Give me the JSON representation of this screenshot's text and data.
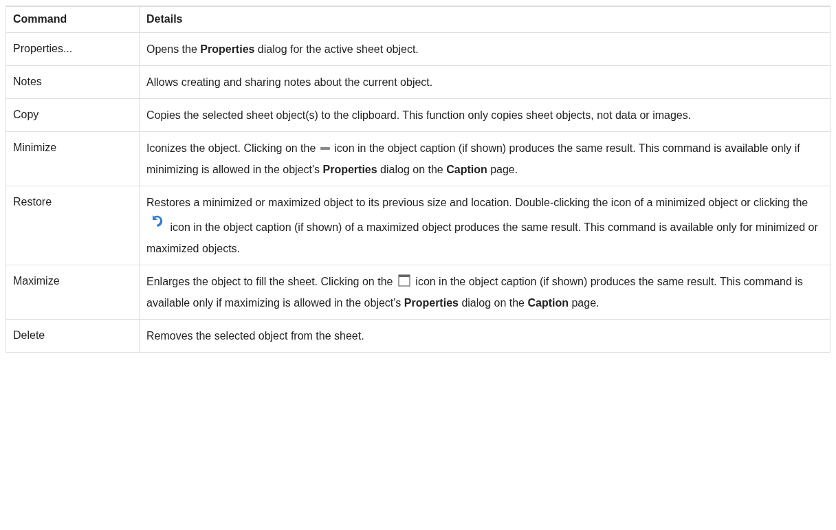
{
  "table": {
    "columns": [
      "Command",
      "Details"
    ],
    "rows": [
      {
        "command": "Properties...",
        "details": [
          {
            "kind": "text",
            "text": "Opens the **Properties** dialog for the active sheet object."
          }
        ]
      },
      {
        "command": "Notes",
        "details": [
          {
            "kind": "text",
            "text": "Allows creating and sharing notes about the current object."
          }
        ]
      },
      {
        "command": "Copy",
        "details": [
          {
            "kind": "text",
            "text": "Copies the selected sheet object(s) to the clipboard. This function only copies sheet objects, not data or images."
          }
        ]
      },
      {
        "command": "Minimize",
        "details": [
          {
            "kind": "text",
            "text": "Iconizes the object. Clicking on the "
          },
          {
            "kind": "dash"
          },
          {
            "kind": "text",
            "text": " icon in the object caption (if shown) produces the same result. This command is available only if minimizing is allowed in the object's **Properties** dialog on the **Caption** page."
          }
        ]
      },
      {
        "command": "Restore",
        "details": [
          {
            "kind": "text",
            "text": "Restores a minimized or maximized object to its previous size and location. Double-clicking the icon of a minimized object or clicking the "
          },
          {
            "kind": "undo"
          },
          {
            "kind": "text",
            "text": " icon in the object caption (if shown) of a maximized object produces the same result. This command is available only for minimized or maximized objects."
          }
        ]
      },
      {
        "command": "Maximize",
        "details": [
          {
            "kind": "text",
            "text": "Enlarges the object to fill the sheet. Clicking on the "
          },
          {
            "kind": "window"
          },
          {
            "kind": "text",
            "text": " icon in the object caption (if shown) produces the same result. This command is available only if maximizing is allowed in the object's **Properties** dialog on the **Caption** page."
          }
        ]
      },
      {
        "command": "Delete",
        "details": [
          {
            "kind": "text",
            "text": "Removes the selected object from the sheet."
          }
        ]
      }
    ]
  }
}
